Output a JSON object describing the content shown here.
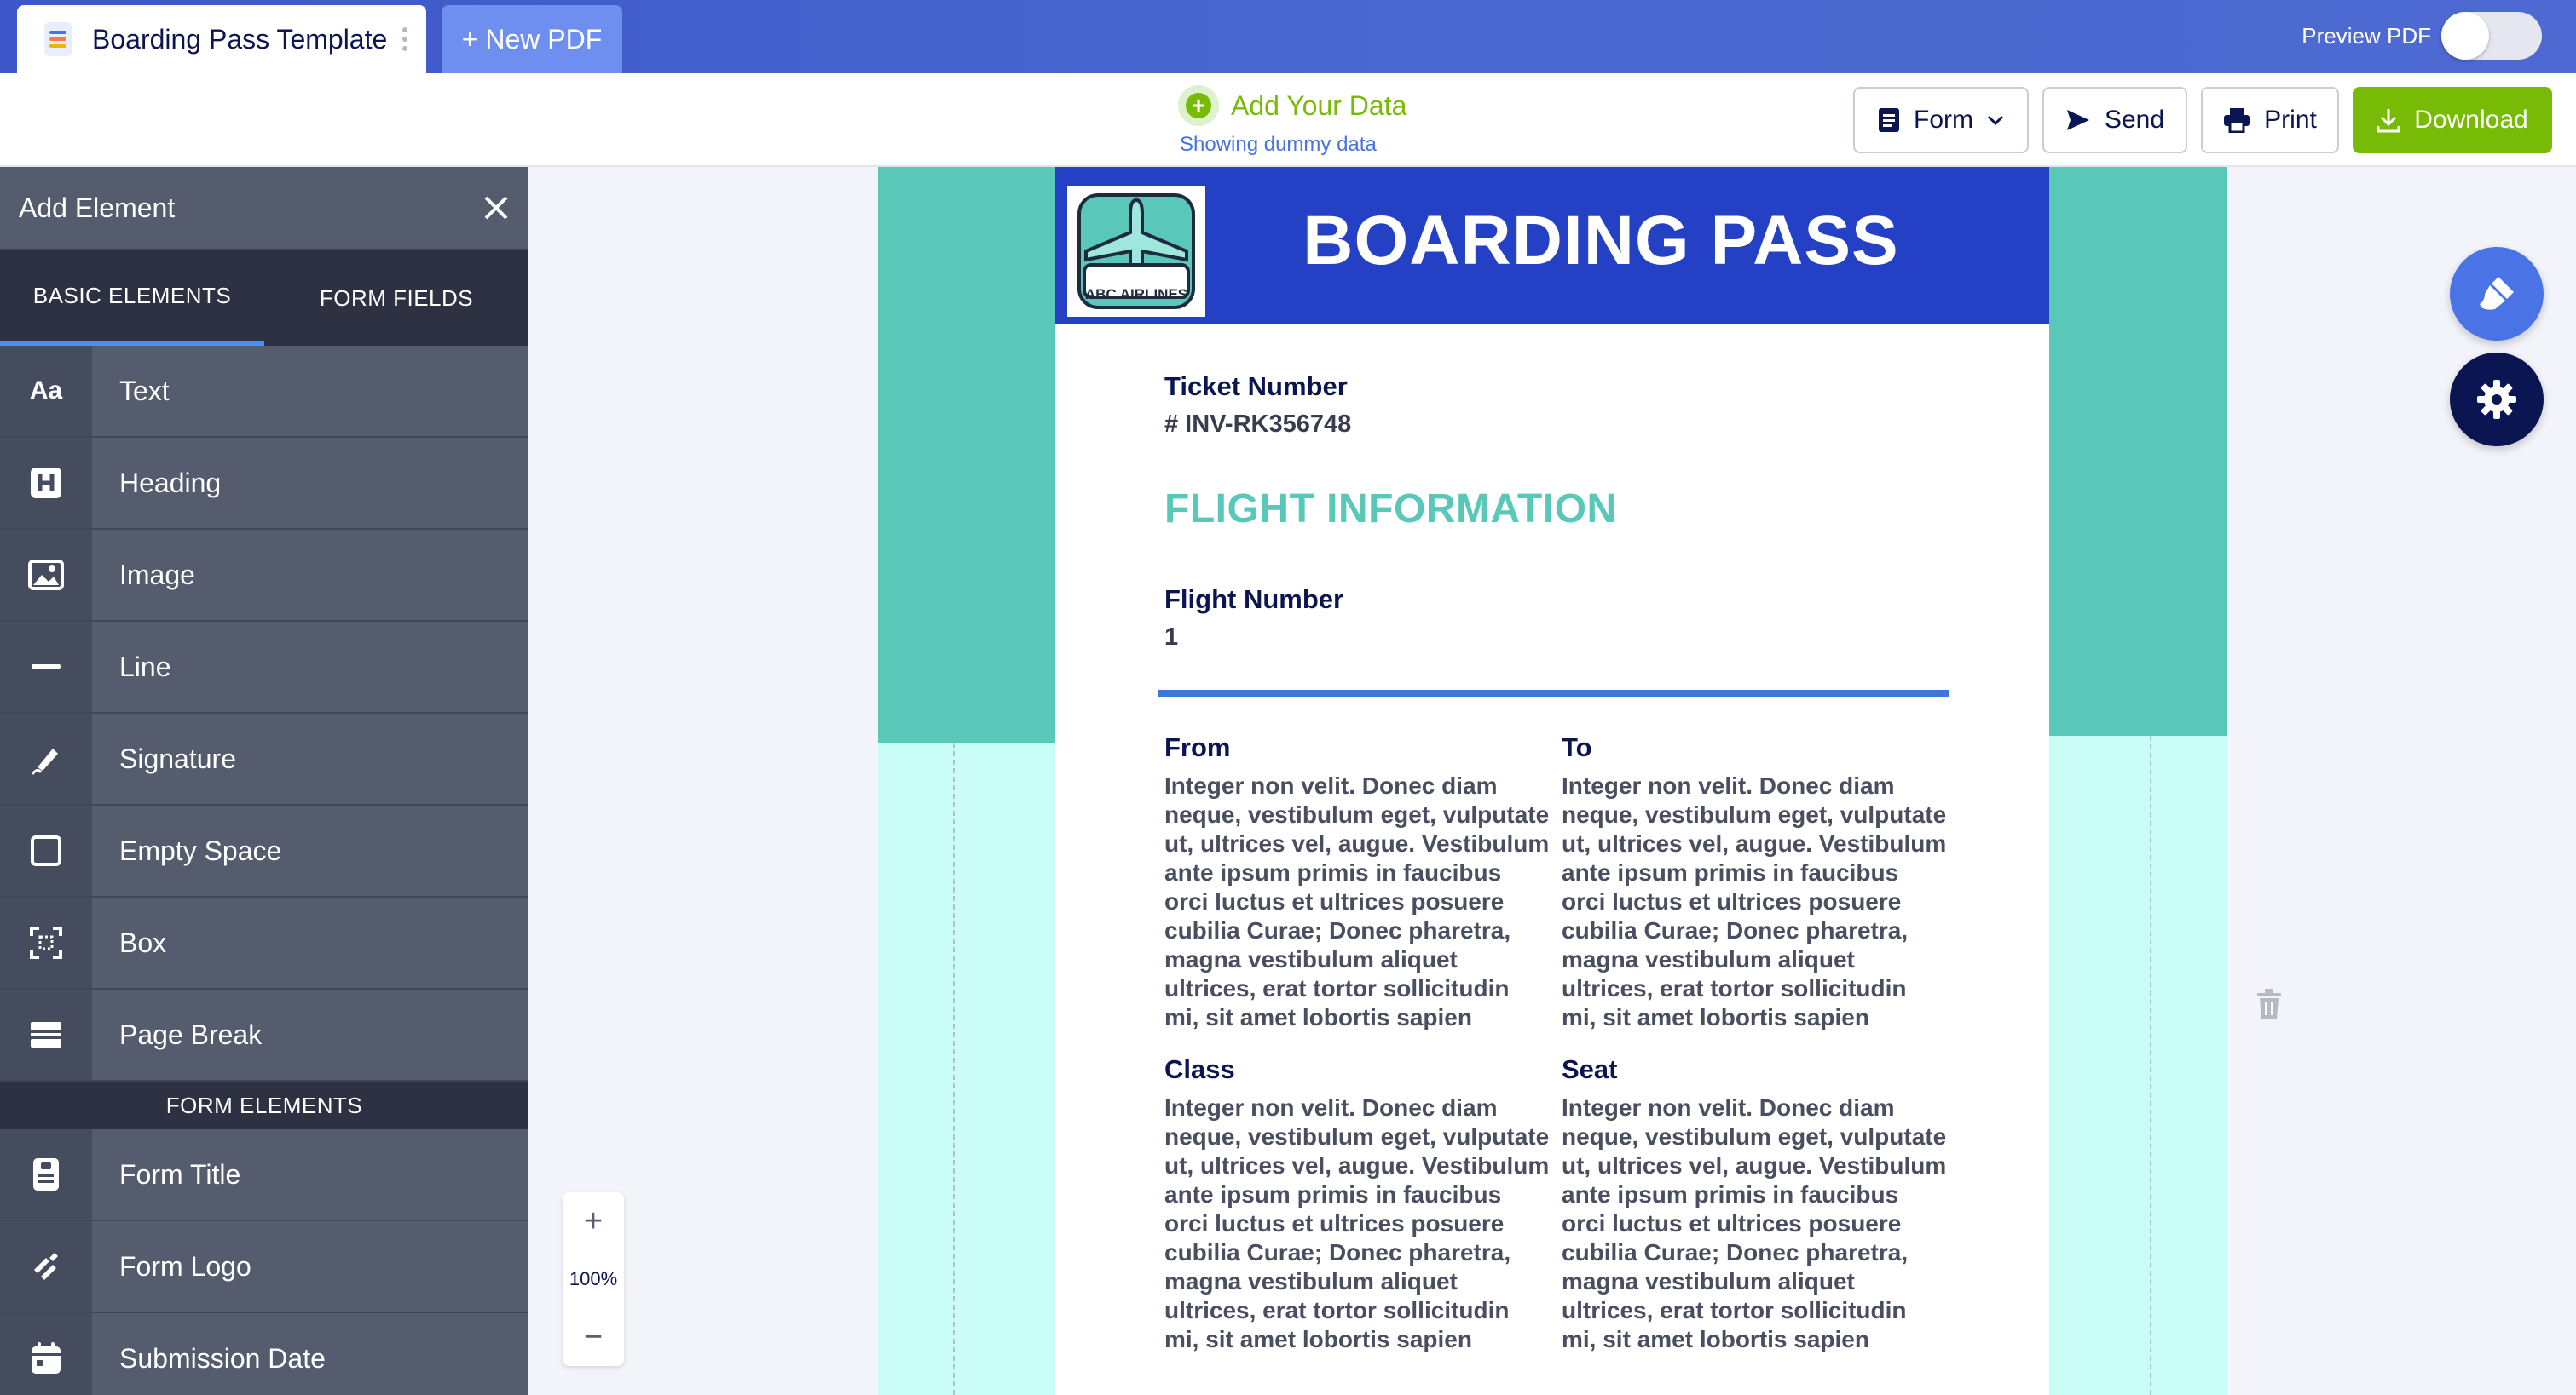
{
  "topbar": {
    "doc_tab_title": "Boarding Pass Template",
    "new_tab_label": "+ New PDF",
    "preview_label": "Preview PDF",
    "preview_enabled": false
  },
  "toolbar": {
    "add_data_label": "Add Your Data",
    "dummy_note": "Showing dummy data",
    "form_label": "Form",
    "send_label": "Send",
    "print_label": "Print",
    "download_label": "Download",
    "download_color": "#78bb07"
  },
  "sidebar": {
    "title": "Add Element",
    "tabs": [
      "BASIC ELEMENTS",
      "FORM FIELDS"
    ],
    "active_tab": "BASIC ELEMENTS",
    "basic_items": [
      {
        "label": "Text",
        "icon": "text-aa-icon"
      },
      {
        "label": "Heading",
        "icon": "heading-icon"
      },
      {
        "label": "Image",
        "icon": "image-icon"
      },
      {
        "label": "Line",
        "icon": "line-icon"
      },
      {
        "label": "Signature",
        "icon": "signature-icon"
      },
      {
        "label": "Empty Space",
        "icon": "empty-space-icon"
      },
      {
        "label": "Box",
        "icon": "box-icon"
      },
      {
        "label": "Page Break",
        "icon": "page-break-icon"
      }
    ],
    "section_label": "FORM ELEMENTS",
    "form_items": [
      {
        "label": "Form Title",
        "icon": "form-title-icon"
      },
      {
        "label": "Form Logo",
        "icon": "form-logo-icon"
      },
      {
        "label": "Submission Date",
        "icon": "calendar-icon"
      }
    ]
  },
  "document": {
    "banner_title": "BOARDING PASS",
    "logo_text": "ABC AIRLINES",
    "ticket_label": "Ticket Number",
    "ticket_value": "# INV-RK356748",
    "section_title": "FLIGHT INFORMATION",
    "flight_label": "Flight Number",
    "flight_value": "1",
    "from_label": "From",
    "to_label": "To",
    "class_label": "Class",
    "seat_label": "Seat",
    "lorem": "Integer non velit. Donec diam neque, vestibulum eget, vulputate ut, ultrices vel, augue. Vestibulum ante ipsum primis in faucibus orci luctus et ultrices posuere cubilia Curae; Donec pharetra, magna vestibulum aliquet ultrices, erat tortor sollicitudin mi, sit amet lobortis sapien sapien non mi.",
    "banner_color": "#2440c4",
    "teal_color": "#5ac8b9"
  },
  "zoom": {
    "in_label": "+",
    "level": "100%",
    "out_label": "−"
  }
}
